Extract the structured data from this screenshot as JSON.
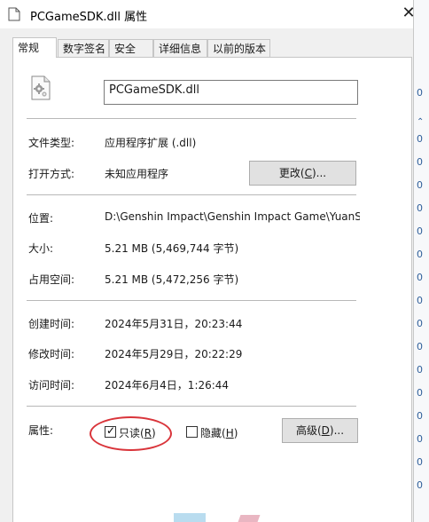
{
  "window": {
    "title": "PCGameSDK.dll 属性",
    "close_glyph": "✕"
  },
  "tabs": [
    {
      "label": "常规",
      "active": true
    },
    {
      "label": "数字签名",
      "active": false
    },
    {
      "label": "安全",
      "active": false
    },
    {
      "label": "详细信息",
      "active": false
    },
    {
      "label": "以前的版本",
      "active": false
    }
  ],
  "general": {
    "file_name": "PCGameSDK.dll",
    "file_type_label": "文件类型:",
    "file_type_value": "应用程序扩展 (.dll)",
    "open_with_label": "打开方式:",
    "open_with_value": "未知应用程序",
    "change_button_text": "更改(",
    "change_button_key": "C",
    "change_button_tail": ")...",
    "location_label": "位置:",
    "location_value": "D:\\Genshin Impact\\Genshin Impact Game\\YuanSh",
    "size_label": "大小:",
    "size_value": "5.21 MB (5,469,744 字节)",
    "size_on_disk_label": "占用空间:",
    "size_on_disk_value": "5.21 MB (5,472,256 字节)",
    "created_label": "创建时间:",
    "created_value": "2024年5月31日，20:23:44",
    "modified_label": "修改时间:",
    "modified_value": "2024年5月29日，20:22:29",
    "accessed_label": "访问时间:",
    "accessed_value": "2024年6月4日，1:26:44",
    "attributes_label": "属性:",
    "readonly_text": "只读(",
    "readonly_key": "R",
    "readonly_tail": ")",
    "readonly_checked": true,
    "hidden_text": "隐藏(",
    "hidden_key": "H",
    "hidden_tail": ")",
    "hidden_checked": false,
    "advanced_button_text": "高级(",
    "advanced_button_key": "D",
    "advanced_button_tail": ")..."
  },
  "background_window": {
    "chars": [
      "0",
      "0",
      "0",
      "0",
      "0",
      "0",
      "0",
      "0",
      "0",
      "0",
      "0",
      "0",
      "0",
      "0",
      "0",
      "0",
      "0"
    ]
  },
  "colors": {
    "highlight_oval": "#d9343a"
  }
}
